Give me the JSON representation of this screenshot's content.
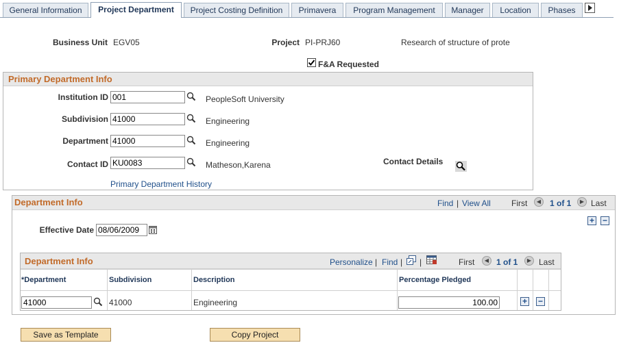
{
  "tabs": [
    {
      "label": "General Information"
    },
    {
      "label": "Project Department"
    },
    {
      "label": "Project Costing Definition"
    },
    {
      "label": "Primavera"
    },
    {
      "label": "Program Management"
    },
    {
      "label": "Manager"
    },
    {
      "label": "Location"
    },
    {
      "label": "Phases"
    }
  ],
  "header": {
    "business_unit_label": "Business Unit",
    "business_unit_value": "EGV05",
    "project_label": "Project",
    "project_value": "PI-PRJ60",
    "project_desc": "Research of structure of prote",
    "fa_requested_label": "F&A Requested",
    "fa_requested_checked": true
  },
  "primary": {
    "title": "Primary Department Info",
    "institution_label": "Institution ID",
    "institution_value": "001",
    "institution_desc": "PeopleSoft University",
    "subdivision_label": "Subdivision",
    "subdivision_value": "41000",
    "subdivision_desc": "Engineering",
    "department_label": "Department",
    "department_value": "41000",
    "department_desc": "Engineering",
    "contact_label": "Contact ID",
    "contact_value": "KU0083",
    "contact_desc": "Matheson,Karena",
    "contact_details_label": "Contact Details",
    "history_link": "Primary Department History"
  },
  "dept_info": {
    "title": "Department Info",
    "find": "Find",
    "view_all": "View All",
    "first": "First",
    "range": "1 of 1",
    "last": "Last",
    "effective_date_label": "Effective Date",
    "effective_date_value": "08/06/2009"
  },
  "grid": {
    "title": "Department Info",
    "personalize": "Personalize",
    "find": "Find",
    "first": "First",
    "range": "1 of 1",
    "last": "Last",
    "columns": [
      "*Department",
      "Subdivision",
      "Description",
      "Percentage Pledged"
    ],
    "rows": [
      {
        "department": "41000",
        "subdivision": "41000",
        "description": "Engineering",
        "percentage": "100.00"
      }
    ]
  },
  "buttons": {
    "save_template": "Save as Template",
    "copy_project": "Copy Project"
  }
}
